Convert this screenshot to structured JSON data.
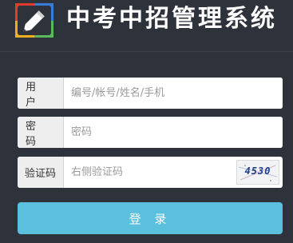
{
  "header": {
    "title": "中考中招管理系统",
    "logo_icon": "pencil-logo-icon"
  },
  "form": {
    "username": {
      "label": "用 户",
      "placeholder": "编号/帐号/姓名/手机",
      "value": ""
    },
    "password": {
      "label": "密 码",
      "placeholder": "密码",
      "value": ""
    },
    "captcha": {
      "label": "验证码",
      "placeholder": "右侧验证码",
      "value": "",
      "image_text": "4530"
    },
    "login_button": "登 录"
  },
  "colors": {
    "background": "#2d323b",
    "button": "#5bc0de",
    "logo_red": "#e23d2c",
    "logo_blue": "#3b7bd8",
    "logo_green": "#5cb85c",
    "logo_yellow": "#f0ad1f"
  }
}
